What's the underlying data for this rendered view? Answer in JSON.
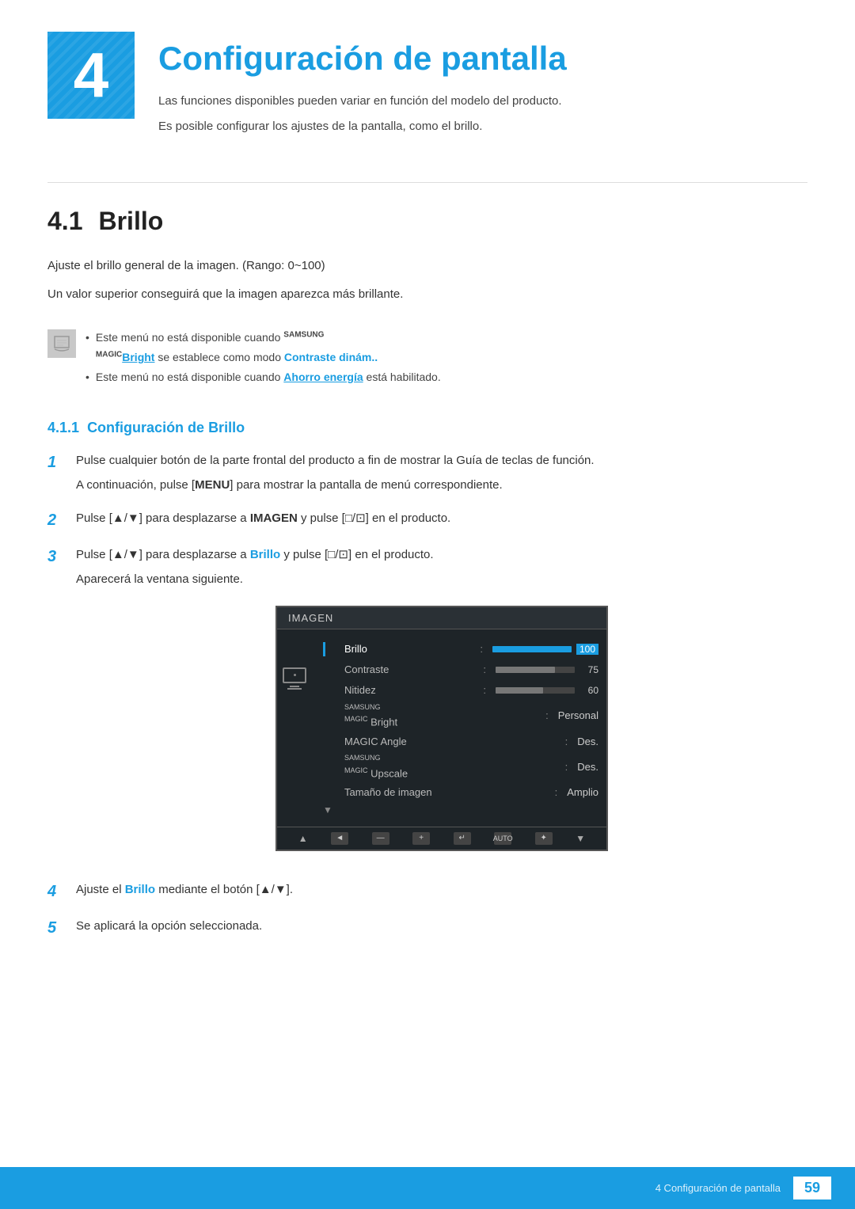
{
  "chapter": {
    "number": "4",
    "title": "Configuración de pantalla",
    "desc1": "Las funciones disponibles pueden variar en función del modelo del producto.",
    "desc2": "Es posible configurar los ajustes de la pantalla, como el brillo."
  },
  "section41": {
    "number": "4.1",
    "title": "Brillo",
    "para1": "Ajuste el brillo general de la imagen. (Rango: 0~100)",
    "para2": "Un valor superior conseguirá que la imagen aparezca más brillante.",
    "note1_pre": "Este menú no está disponible cuando ",
    "note1_brand": "SAMSUNG",
    "note1_magic": "MAGIC",
    "note1_link": "Bright",
    "note1_mid": " se establece como modo ",
    "note1_bold": "Contraste dinám..",
    "note2_pre": "Este menú no está disponible cuando ",
    "note2_link": "Ahorro energía",
    "note2_post": " está habilitado."
  },
  "subsection411": {
    "number": "4.1.1",
    "title": "Configuración de Brillo"
  },
  "steps": {
    "step1_main": "Pulse cualquier botón de la parte frontal del producto a fin de mostrar la Guía de teclas de función.",
    "step1_sub": "A continuación, pulse [MENU] para mostrar la pantalla de menú correspondiente.",
    "step1_menu_keyword": "MENU",
    "step2": "Pulse [▲/▼] para desplazarse a IMAGEN y pulse [□/⊡] en el producto.",
    "step2_bold": "IMAGEN",
    "step3": "Pulse [▲/▼] para desplazarse a Brillo y pulse [□/⊡] en el producto.",
    "step3_bold": "Brillo",
    "step3_sub": "Aparecerá la ventana siguiente.",
    "step4": "Ajuste el Brillo mediante el botón [▲/▼].",
    "step4_bold": "Brillo",
    "step5": "Se aplicará la opción seleccionada."
  },
  "menu_screenshot": {
    "header": "IMAGEN",
    "items": [
      {
        "label": "Brillo",
        "type": "bar",
        "fill": "full",
        "value": "100",
        "active": true
      },
      {
        "label": "Contraste",
        "type": "bar",
        "fill": "75",
        "value": "75",
        "active": false
      },
      {
        "label": "Nitidez",
        "type": "bar",
        "fill": "60",
        "value": "60",
        "active": false
      },
      {
        "label": "SAMSUNG MAGIC Bright",
        "type": "text",
        "value": "Personal",
        "active": false
      },
      {
        "label": "MAGIC Angle",
        "type": "text",
        "value": "Des.",
        "active": false
      },
      {
        "label": "SAMSUNG MAGIC Upscale",
        "type": "text",
        "value": "Des.",
        "active": false
      },
      {
        "label": "Tamaño de imagen",
        "type": "text",
        "value": "Amplio",
        "active": false
      }
    ],
    "footer_buttons": [
      "◄",
      "—",
      "✛",
      "↵",
      "AUTO",
      "✦"
    ]
  },
  "footer": {
    "chapter_text": "4 Configuración de pantalla",
    "page_number": "59"
  }
}
